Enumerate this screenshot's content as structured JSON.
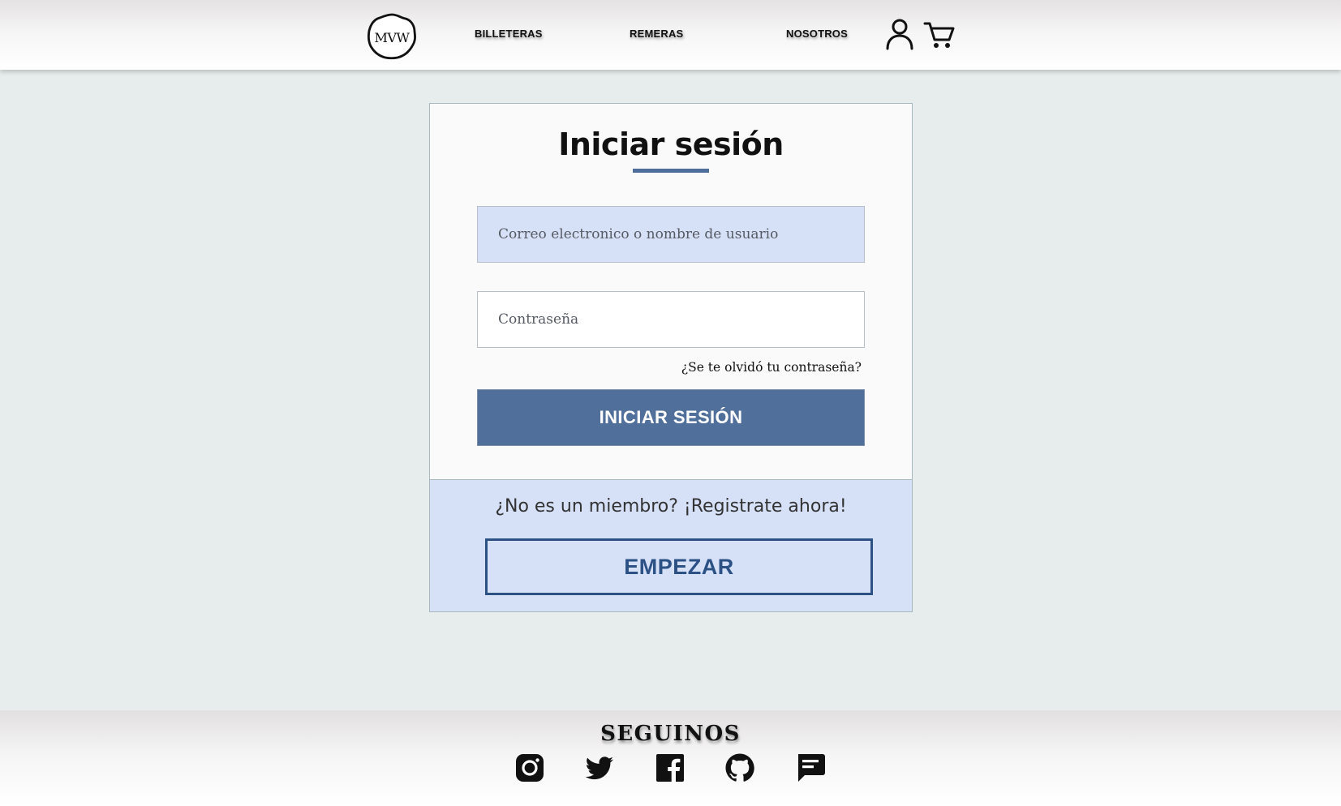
{
  "header": {
    "logo_text": "MVW",
    "nav": [
      {
        "label": "BILLETERAS"
      },
      {
        "label": "REMERAS"
      },
      {
        "label": "NOSOTROS"
      }
    ],
    "icons": [
      "user-icon",
      "cart-icon"
    ]
  },
  "login": {
    "title": "Iniciar sesión",
    "email_placeholder": "Correo electronico o nombre de usuario",
    "email_value": "",
    "password_placeholder": "Contraseña",
    "password_value": "",
    "forgot_label": "¿Se te olvidó tu contraseña?",
    "submit_label": "INICIAR SESIÓN",
    "register_text": "¿No es un miembro? ¡Registrate ahora!",
    "start_label": "EMPEZAR"
  },
  "footer": {
    "title": "SEGUINOS",
    "social_icons": [
      "instagram-icon",
      "twitter-icon",
      "facebook-icon",
      "github-icon",
      "chat-icon"
    ]
  },
  "colors": {
    "page_bg": "#e7ecec",
    "accent": "#516f9b",
    "email_field_bg": "#d6e1f8",
    "start_border": "#2b5185"
  }
}
